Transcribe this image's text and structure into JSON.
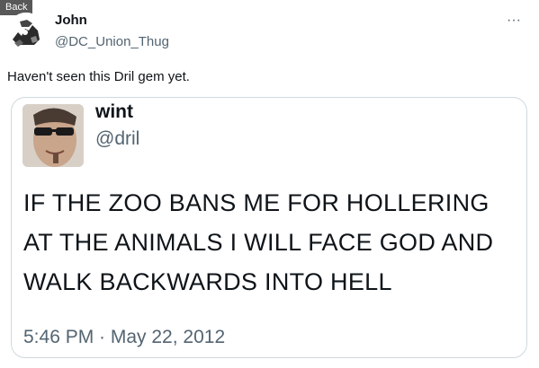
{
  "back_label": "Back",
  "tweet": {
    "author_name": "John",
    "author_handle": "@DC_Union_Thug",
    "more_icon": "···",
    "text": "Haven't seen this Dril gem yet."
  },
  "quoted_tweet": {
    "author_name": "wint",
    "author_handle": "@dril",
    "lines": [
      "IF THE ZOO BANS ME FOR HOLLERING",
      "AT THE ANIMALS I WILL FACE GOD AND",
      "WALK BACKWARDS INTO HELL"
    ],
    "timestamp": "5:46 PM · May 22, 2012"
  }
}
